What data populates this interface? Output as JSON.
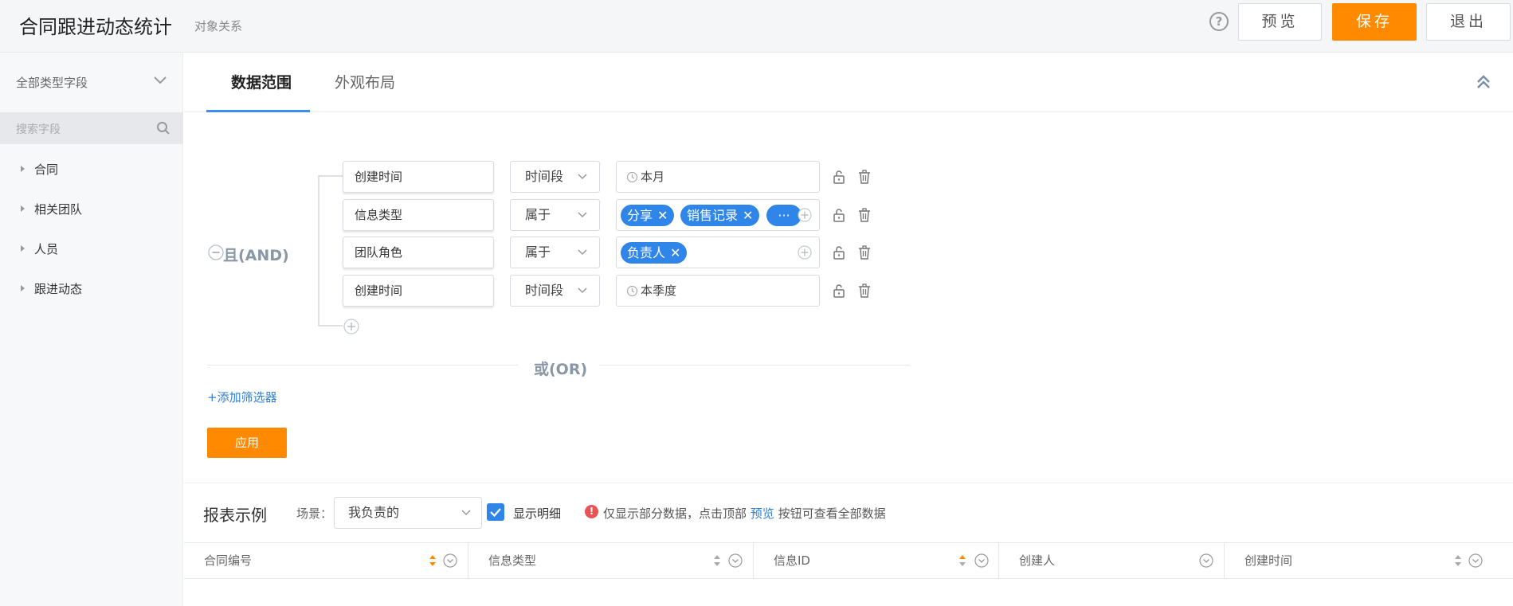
{
  "header": {
    "title": "合同跟进动态统计",
    "subtitle": "对象关系",
    "help": "?",
    "preview_label": "预览",
    "save_label": "保存",
    "exit_label": "退出"
  },
  "sidebar": {
    "field_type": "全部类型字段",
    "search_placeholder": "搜索字段",
    "items": [
      {
        "label": "合同"
      },
      {
        "label": "相关团队"
      },
      {
        "label": "人员"
      },
      {
        "label": "跟进动态"
      }
    ]
  },
  "tabs": {
    "range": "数据范围",
    "layout": "外观布局"
  },
  "filter": {
    "and_label": "且(AND)",
    "or_label": "或(OR)",
    "add_filter": "+添加筛选器",
    "apply": "应用",
    "rows": [
      {
        "field": "创建时间",
        "operator": "时间段",
        "value": "本月"
      },
      {
        "field": "信息类型",
        "operator": "属于",
        "chips": [
          "分享",
          "销售记录",
          "···"
        ]
      },
      {
        "field": "团队角色",
        "operator": "属于",
        "chips": [
          "负责人"
        ]
      },
      {
        "field": "创建时间",
        "operator": "时间段",
        "value": "本季度"
      }
    ]
  },
  "report": {
    "title": "报表示例",
    "scene_label": "场景：",
    "scene_value": "我负责的",
    "show_detail": "显示明细",
    "show_detail_checked": true,
    "notice_pre": "仅显示部分数据，点击顶部",
    "notice_link": "预览",
    "notice_post": "按钮可查看全部数据",
    "columns": [
      "合同编号",
      "信息类型",
      "信息ID",
      "创建人",
      "创建时间"
    ]
  },
  "colors": {
    "accent_orange": "#ff8a00",
    "accent_blue": "#2f86e8",
    "link_blue": "#2f7fd8",
    "warning_red": "#e95555"
  }
}
